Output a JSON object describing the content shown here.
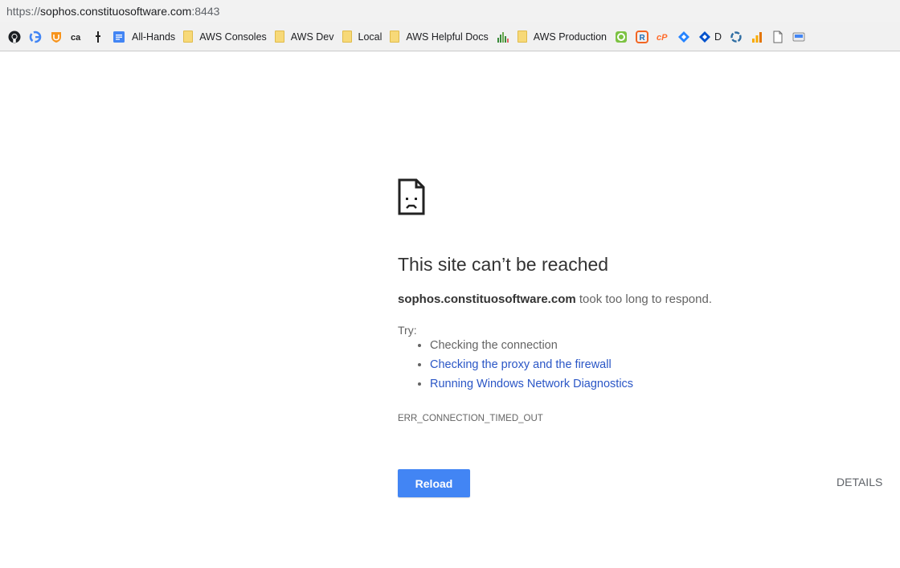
{
  "address_bar": {
    "scheme": "https://",
    "host": "sophos.constituosoftware.com",
    "port": ":8443"
  },
  "bookmarks": [
    {
      "icon": "github-icon",
      "label": ""
    },
    {
      "icon": "google-icon",
      "label": ""
    },
    {
      "icon": "orange-shield-icon",
      "label": ""
    },
    {
      "icon": "ca-logo-icon",
      "label": ""
    },
    {
      "icon": "pin-icon",
      "label": ""
    },
    {
      "icon": "google-docs-icon",
      "label": "All-Hands"
    },
    {
      "icon": "folder-icon",
      "label": "AWS Consoles"
    },
    {
      "icon": "folder-icon",
      "label": "AWS Dev"
    },
    {
      "icon": "folder-icon",
      "label": "Local"
    },
    {
      "icon": "folder-icon",
      "label": "AWS Helpful Docs"
    },
    {
      "icon": "chart-icon",
      "label": ""
    },
    {
      "icon": "folder-icon",
      "label": "AWS Production"
    },
    {
      "icon": "green-circle-icon",
      "label": ""
    },
    {
      "icon": "orange-r-icon",
      "label": ""
    },
    {
      "icon": "cpanel-icon",
      "label": ""
    },
    {
      "icon": "jira-icon",
      "label": ""
    },
    {
      "icon": "jira-icon",
      "label": "D"
    },
    {
      "icon": "ring-icon",
      "label": ""
    },
    {
      "icon": "analytics-icon",
      "label": ""
    },
    {
      "icon": "page-icon",
      "label": ""
    },
    {
      "icon": "drive-icon",
      "label": ""
    }
  ],
  "error": {
    "title": "This site can’t be reached",
    "host": "sophos.constituosoftware.com",
    "message": " took too long to respond.",
    "try_label": "Try:",
    "suggestions": [
      {
        "text": "Checking the connection",
        "link": false
      },
      {
        "text": "Checking the proxy and the firewall",
        "link": true
      },
      {
        "text": "Running Windows Network Diagnostics",
        "link": true
      }
    ],
    "code": "ERR_CONNECTION_TIMED_OUT",
    "reload_label": "Reload",
    "details_label": "DETAILS"
  },
  "colors": {
    "link": "#2a56c6",
    "reload_button": "#4285f4",
    "folder": "#f7d978"
  }
}
